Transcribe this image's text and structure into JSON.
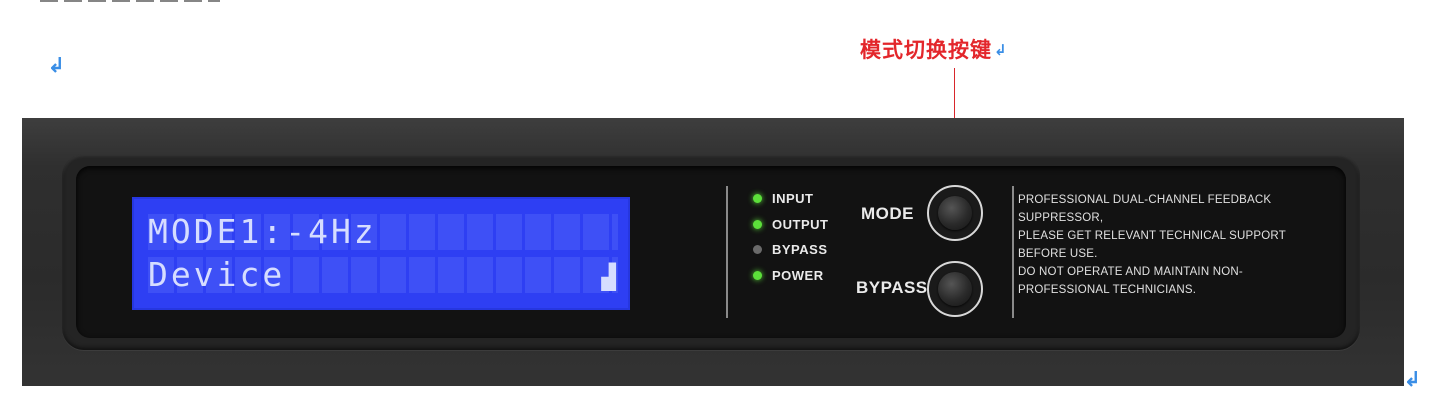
{
  "callout": {
    "label": "模式切换按键"
  },
  "lcd": {
    "line1": "MODE1:-4Hz",
    "line2": "Device",
    "lock_glyph": "▟"
  },
  "indicators": [
    {
      "label": "INPUT",
      "state": "on"
    },
    {
      "label": "OUTPUT",
      "state": "on"
    },
    {
      "label": "BYPASS",
      "state": "off"
    },
    {
      "label": "POWER",
      "state": "on"
    }
  ],
  "buttons": {
    "mode_label": "MODE",
    "bypass_label": "BYPASS"
  },
  "notice": {
    "lines": [
      "PROFESSIONAL DUAL-CHANNEL FEEDBACK",
      "SUPPRESSOR,",
      "PLEASE GET RELEVANT TECHNICAL SUPPORT",
      "BEFORE USE.",
      "DO NOT OPERATE AND MAINTAIN NON-",
      "PROFESSIONAL TECHNICIANS."
    ]
  },
  "colors": {
    "callout": "#e3262b",
    "lcd_background": "#2e3ff3",
    "led_on": "#5cdf3a",
    "led_off": "#6a6a6a",
    "return_mark": "#3a8ee6"
  },
  "icons": {
    "return_mark": "↲"
  }
}
